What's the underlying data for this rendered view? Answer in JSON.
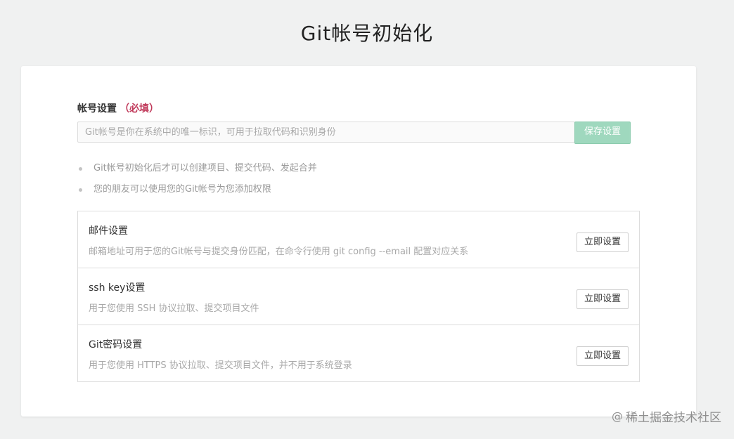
{
  "page": {
    "title": "Git帐号初始化"
  },
  "account": {
    "label": "帐号设置",
    "required_label": "（必填）",
    "input_placeholder": "Git帐号是你在系统中的唯一标识，可用于拉取代码和识别身份",
    "input_value": "",
    "save_label": "保存设置"
  },
  "tips": [
    {
      "text": "Git帐号初始化后才可以创建项目、提交代码、发起合并"
    },
    {
      "text": "您的朋友可以使用您的Git帐号为您添加权限"
    }
  ],
  "settings": [
    {
      "title": "邮件设置",
      "description": "邮箱地址可用于您的Git帐号与提交身份匹配，在命令行使用 git config --email 配置对应关系",
      "button_label": "立即设置"
    },
    {
      "title": "ssh key设置",
      "description": "用于您使用 SSH 协议拉取、提交项目文件",
      "button_label": "立即设置"
    },
    {
      "title": "Git密码设置",
      "description": "用于您使用 HTTPS 协议拉取、提交项目文件，并不用于系统登录",
      "button_label": "立即设置"
    }
  ],
  "watermark": {
    "symbol": "@",
    "text": "稀土掘金技术社区"
  },
  "colors": {
    "background": "#f0f1f1",
    "card": "#ffffff",
    "required": "#c0395a",
    "save_button": "#9fd8be",
    "muted_text": "#a8a8a8"
  }
}
